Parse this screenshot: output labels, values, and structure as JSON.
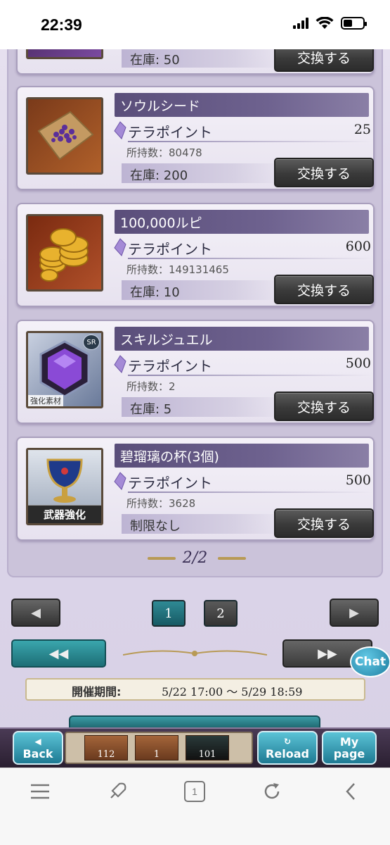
{
  "status": {
    "time": "22:39"
  },
  "items": [
    {
      "title": "ソウルシード",
      "cost_label": "テラポイント",
      "cost": "25",
      "owned": "所持数：80478",
      "stock": "在庫: 200",
      "button": "交換する",
      "icon": "soul-seed-icon"
    },
    {
      "title": "100,000ルピ",
      "cost_label": "テラポイント",
      "cost": "600",
      "owned": "所持数：149131465",
      "stock": "在庫: 10",
      "button": "交換する",
      "icon": "rupie-coins-icon"
    },
    {
      "title": "スキルジュエル",
      "cost_label": "テラポイント",
      "cost": "500",
      "owned": "所持数：2",
      "stock": "在庫: 5",
      "button": "交換する",
      "icon": "skill-jewel-icon",
      "badge": "SR",
      "tag": "強化素材"
    },
    {
      "title": "碧瑠璃の杯(3個)",
      "cost_label": "テラポイント",
      "cost": "500",
      "owned": "所持数：3628",
      "stock": "制限なし",
      "button": "交換する",
      "icon": "lapis-goblet-icon",
      "tag": "武器強化"
    }
  ],
  "partial_top": {
    "stock": "在庫: 50"
  },
  "page_indicator": "2/2",
  "pager": {
    "pages": [
      "1",
      "2"
    ],
    "current": "1",
    "prev": "◀",
    "next": "▶",
    "first": "◀◀",
    "last": "▶▶"
  },
  "chat_label": "Chat",
  "period": {
    "label": "開催期間:",
    "value": "5/22 17:00 〜 5/29 18:59"
  },
  "game_nav": {
    "back": "Back",
    "reload": "Reload",
    "mypage_1": "My",
    "mypage_2": "page",
    "resources": [
      "112",
      "1",
      "101"
    ]
  },
  "browser": {
    "tab_count": "1"
  }
}
